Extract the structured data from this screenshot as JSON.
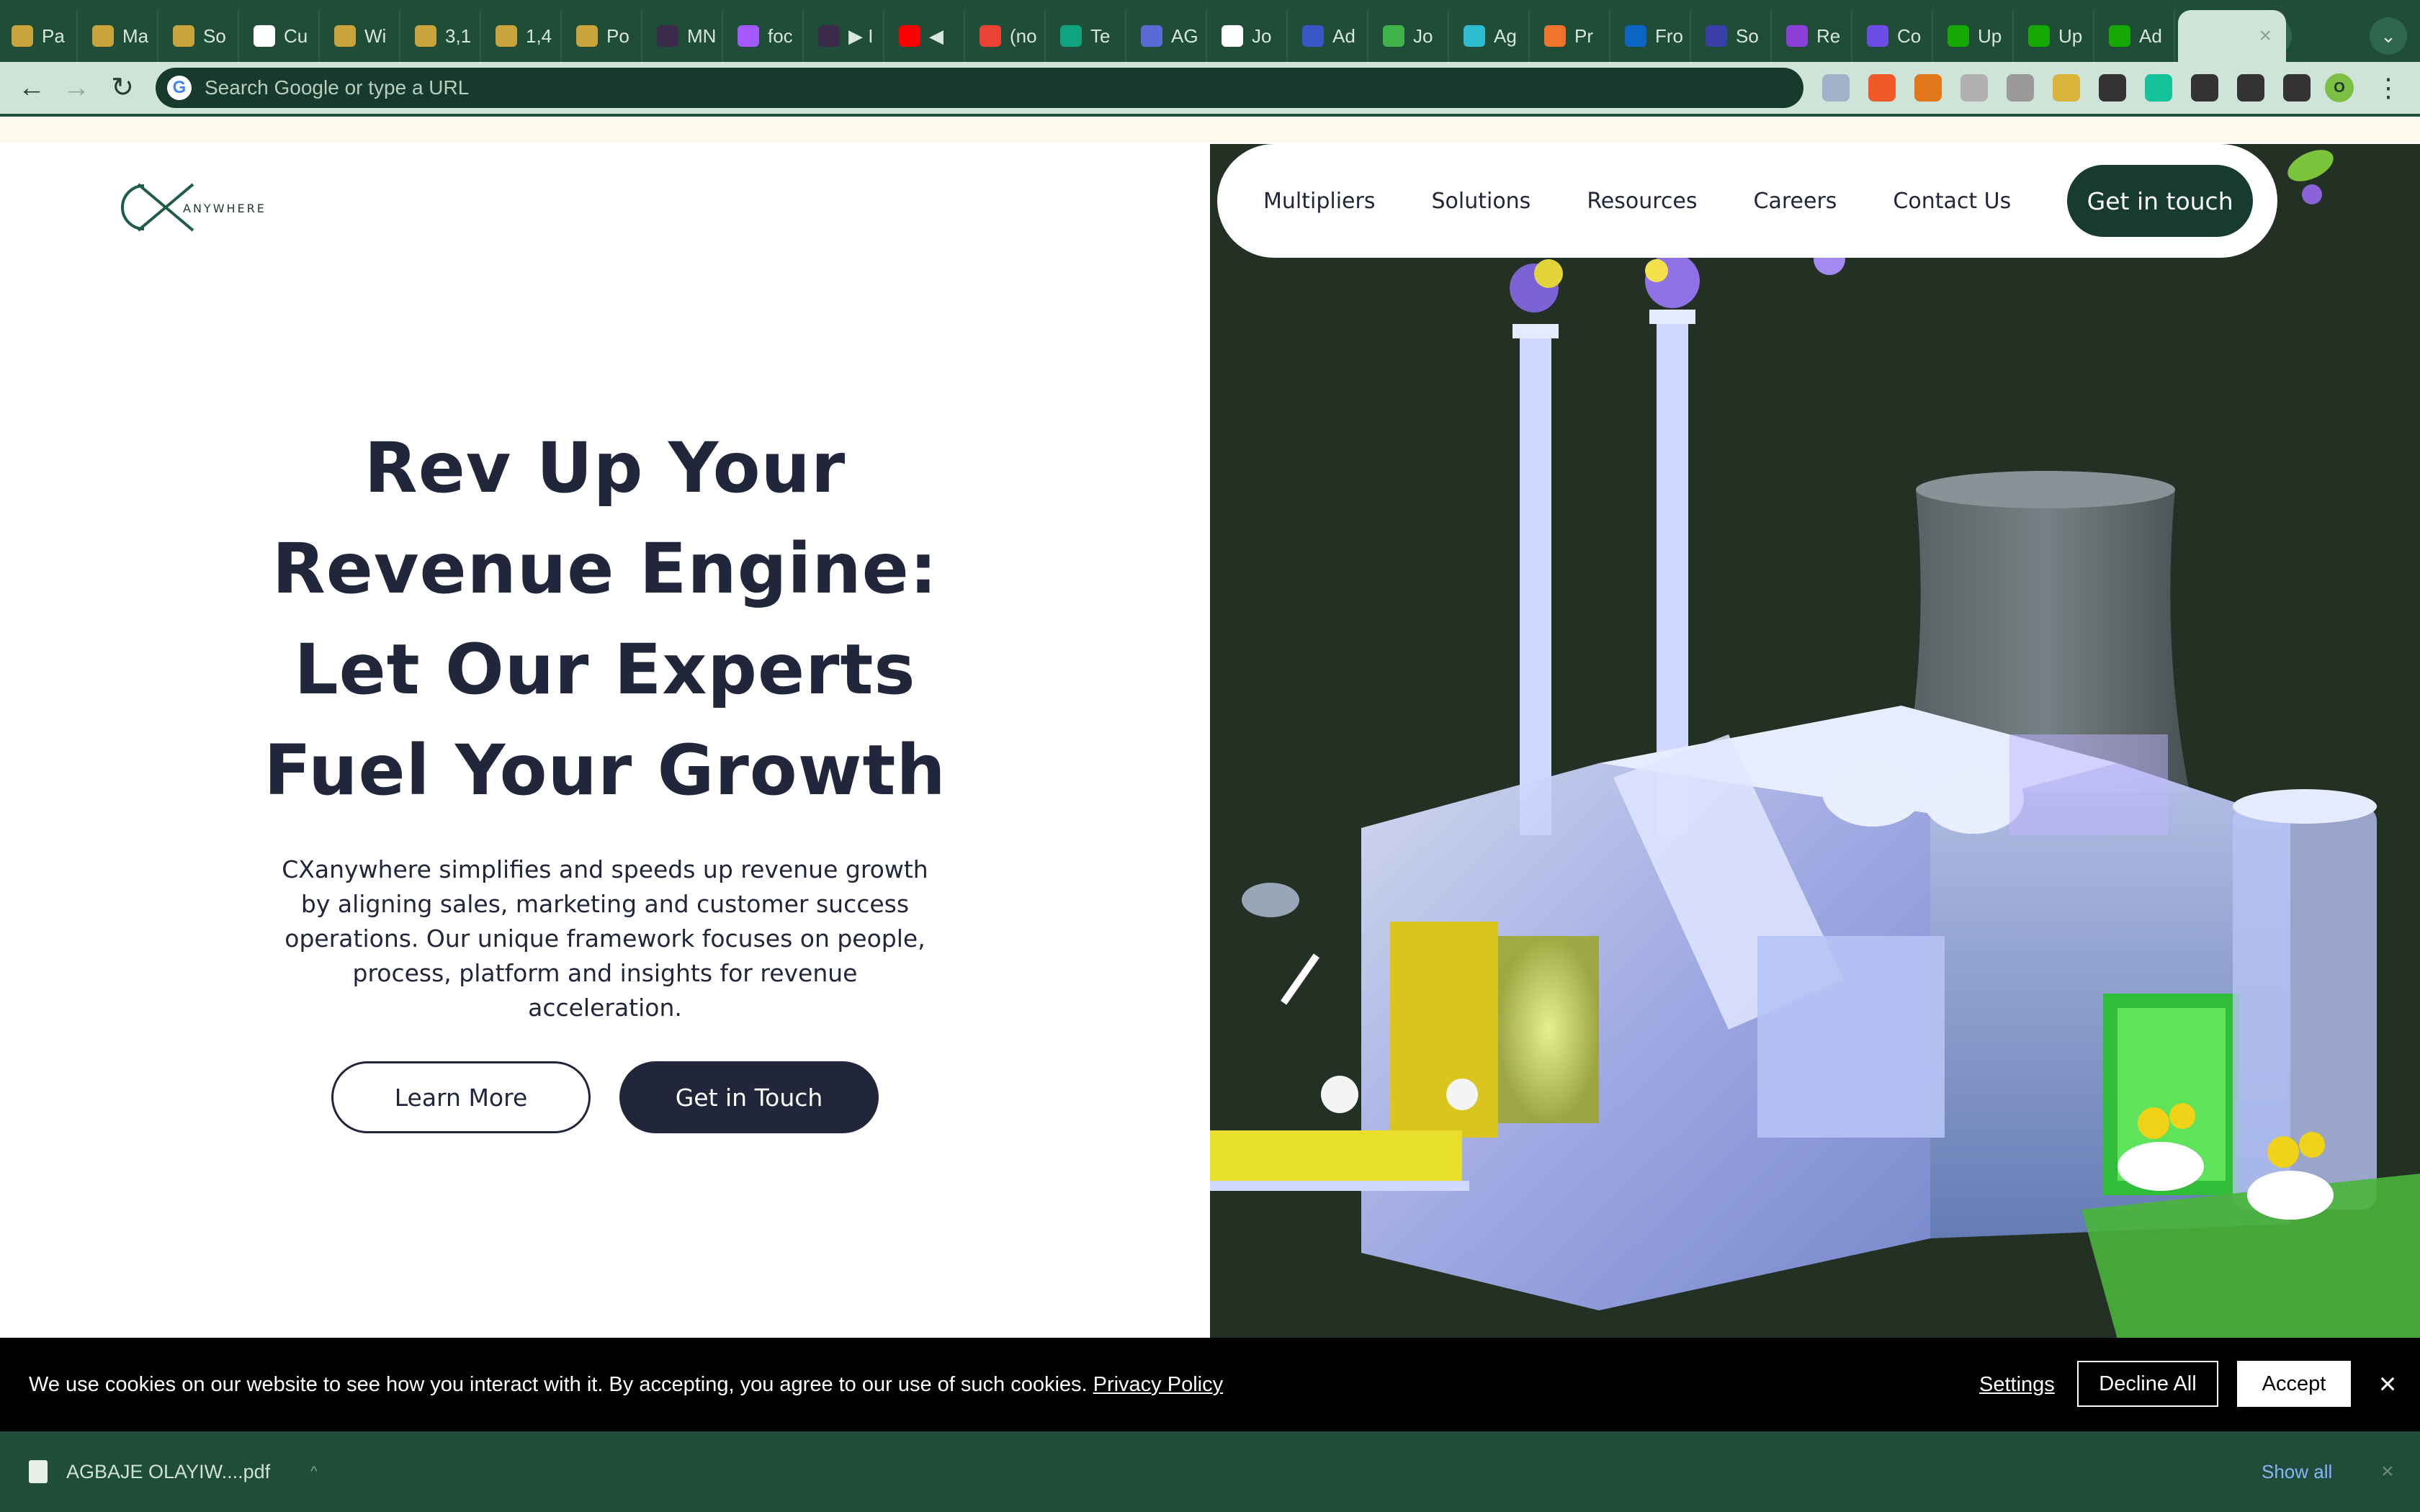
{
  "browser": {
    "tabs": [
      {
        "label": "Pa",
        "color": "#c8a43a"
      },
      {
        "label": "Ma",
        "color": "#c8a43a"
      },
      {
        "label": "So",
        "color": "#c8a43a"
      },
      {
        "label": "Cu",
        "color": "#ffffff"
      },
      {
        "label": "Wi",
        "color": "#c8a43a"
      },
      {
        "label": "3,1",
        "color": "#c8a43a"
      },
      {
        "label": "1,4",
        "color": "#c8a43a"
      },
      {
        "label": "Po",
        "color": "#c8a43a"
      },
      {
        "label": "MN",
        "color": "#3b2b4a"
      },
      {
        "label": "foc",
        "color": "#a259ff"
      },
      {
        "label": "▶ I",
        "color": "#3b2b4a"
      },
      {
        "label": "◀",
        "color": "#ff0000"
      },
      {
        "label": "(no",
        "color": "#ea4335"
      },
      {
        "label": "Te",
        "color": "#10a37f"
      },
      {
        "label": "AG",
        "color": "#5b6bd6"
      },
      {
        "label": "Jo",
        "color": "#ffffff"
      },
      {
        "label": "Ad",
        "color": "#3a56c5"
      },
      {
        "label": "Jo",
        "color": "#3fb24a"
      },
      {
        "label": "Ag",
        "color": "#2dbdd1"
      },
      {
        "label": "Pr",
        "color": "#f0742b"
      },
      {
        "label": "Fro",
        "color": "#0a66c2"
      },
      {
        "label": "So",
        "color": "#3a3fa8"
      },
      {
        "label": "Re",
        "color": "#8b3fd6"
      },
      {
        "label": "Co",
        "color": "#6b4de6"
      },
      {
        "label": "Up",
        "color": "#14a800"
      },
      {
        "label": "Up",
        "color": "#14a800"
      },
      {
        "label": "Ad",
        "color": "#14a800"
      }
    ],
    "new_tab_label": "+",
    "tab_menu_label": "⌄",
    "active_tab_close": "×",
    "back_label": "←",
    "forward_label": "→",
    "reload_label": "↻",
    "omnibox_placeholder": "Search Google or type a URL",
    "google_letter": "G",
    "extensions": [
      "#9fb2c8",
      "#f05a28",
      "#e2761b",
      "#b0b0b0",
      "#9a9a9a",
      "#d8b43a",
      "#333333",
      "#15c39a",
      "#333333",
      "#333333",
      "#333333"
    ],
    "profile_initial": "O",
    "menu_label": "⋮"
  },
  "site": {
    "logo_mark": "CX",
    "logo_word": "ANYWHERE",
    "nav": [
      "Multipliers",
      "Solutions",
      "Resources",
      "Careers",
      "Contact Us"
    ],
    "nav_cta": "Get in touch",
    "hero_lines": [
      "Rev Up Your",
      "Revenue Engine:",
      "Let Our Experts",
      "Fuel Your Growth"
    ],
    "hero_body": "CXanywhere simplifies and speeds up revenue growth by aligning sales, marketing and customer success operations. Our unique framework focuses on people, process, platform and insights for revenue acceleration.",
    "learn_more": "Learn More",
    "get_in_touch": "Get in Touch"
  },
  "cookie": {
    "message": "We use cookies on our website to see how you interact with it. By accepting, you agree to our use of such cookies.",
    "policy_link": "Privacy Policy",
    "settings": "Settings",
    "decline": "Decline All",
    "accept": "Accept",
    "close": "×"
  },
  "downloads": {
    "file_name": "AGBAJE OLAYIW....pdf",
    "chevron": "^",
    "show_all": "Show all",
    "close": "×"
  },
  "colors": {
    "tab_strip": "#1f4d3a",
    "toolbar": "#cfe4d8",
    "heading": "#22263a",
    "nav_cta": "#173b30",
    "art_bg": "#233024"
  }
}
